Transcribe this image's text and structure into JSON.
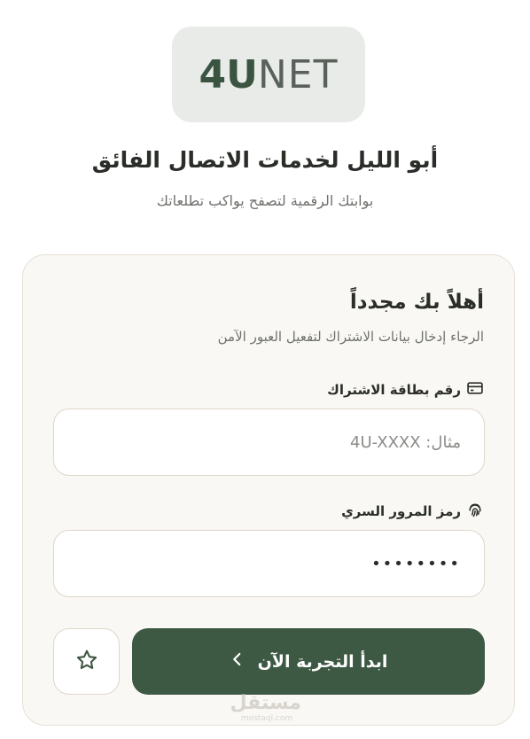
{
  "logo": {
    "bold": "4U",
    "light": "NET"
  },
  "header": {
    "title": "أبو الليل لخدمات الاتصال الفائق",
    "subtitle": "بوابتك الرقمية لتصفح يواكب تطلعاتك"
  },
  "card": {
    "welcome": "أهلاً بك مجدداً",
    "hint": "الرجاء إدخال بيانات الاشتراك لتفعيل العبور الآمن"
  },
  "subscription": {
    "label": "رقم بطاقة الاشتراك",
    "placeholder": "مثال: 4U-XXXX",
    "icon": "credit-card-icon"
  },
  "password": {
    "label": "رمز المرور السري",
    "value": "••••••••",
    "icon": "fingerprint-icon"
  },
  "actions": {
    "start_label": "ابدأ التجربة الآن",
    "start_icon": "chevron-left-icon",
    "favorite_icon": "star-icon"
  },
  "watermark": {
    "arabic": "مستقل",
    "latin": "mostaql.com"
  },
  "colors": {
    "brand": "#3d5843",
    "logo_bg": "#e8ebe7",
    "card_bg": "#faf8f5",
    "border": "#ded7c9"
  }
}
